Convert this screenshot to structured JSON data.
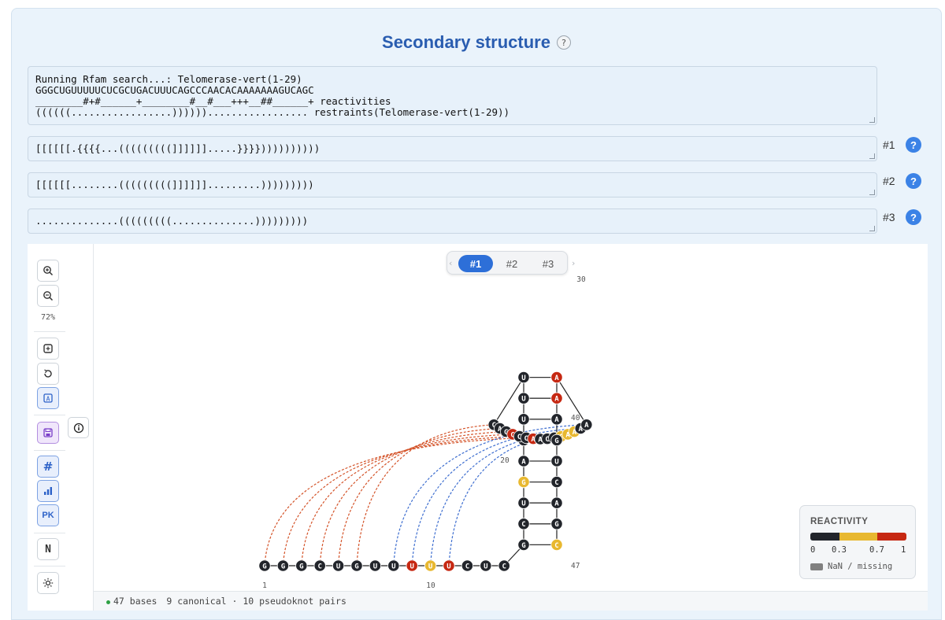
{
  "title": "Secondary structure",
  "help_label": "?",
  "main_text": {
    "line1": "Running Rfam search...: Telomerase-vert(1-29)",
    "line2": "GGGCUGUUUUUCUCGCUGACUUUCAGCCCAACACAAAAAAAGUCAGC",
    "line3": "________#+#______+________#__#___+++__##______+ reactivities",
    "line4": "((((((.................))))))................. restraints(Telomerase-vert(1-29))"
  },
  "structures": [
    {
      "label": "#1",
      "dotbracket": "[[[[[[.{{{{...(((((((((]]]]]].....}}}}))))))))))"
    },
    {
      "label": "#2",
      "dotbracket": "[[[[[[........(((((((((]]]]]].........)))))))))"
    },
    {
      "label": "#3",
      "dotbracket": "..............(((((((((..............)))))))))"
    }
  ],
  "toolbar": {
    "zoom_in_icon": "zoom-in-icon",
    "zoom_out_icon": "zoom-out-icon",
    "zoom_level": "72%",
    "fit_icon": "fit-view-icon",
    "reset_icon": "reset-rotate-icon",
    "label_icon": "label-toggle-icon",
    "save_icon": "save-icon",
    "numbering_label": "#",
    "reactivity_icon": "bar-chart-icon",
    "pk_label": "PK",
    "n_label": "N",
    "settings_icon": "sun-icon",
    "info_icon": "info-icon"
  },
  "tabs": [
    "#1",
    "#2",
    "#3"
  ],
  "active_tab": "#1",
  "legend": {
    "title": "REACTIVITY",
    "ticks": [
      "0",
      "0.3",
      "0.7",
      "1"
    ],
    "nan_label": "NaN / missing",
    "colors": {
      "low": "#22252b",
      "mid": "#e8b830",
      "high": "#c62812",
      "nan": "#808080"
    }
  },
  "plot": {
    "number_labels": [
      "1",
      "10",
      "20",
      "30",
      "40",
      "47"
    ],
    "pair_line_colors": {
      "bracket": "#d4542a",
      "brace": "#3f6fd0",
      "stem": "#333333"
    }
  },
  "status": {
    "bases": "47 bases",
    "pairs": "9 canonical · 10 pseudoknot pairs"
  }
}
